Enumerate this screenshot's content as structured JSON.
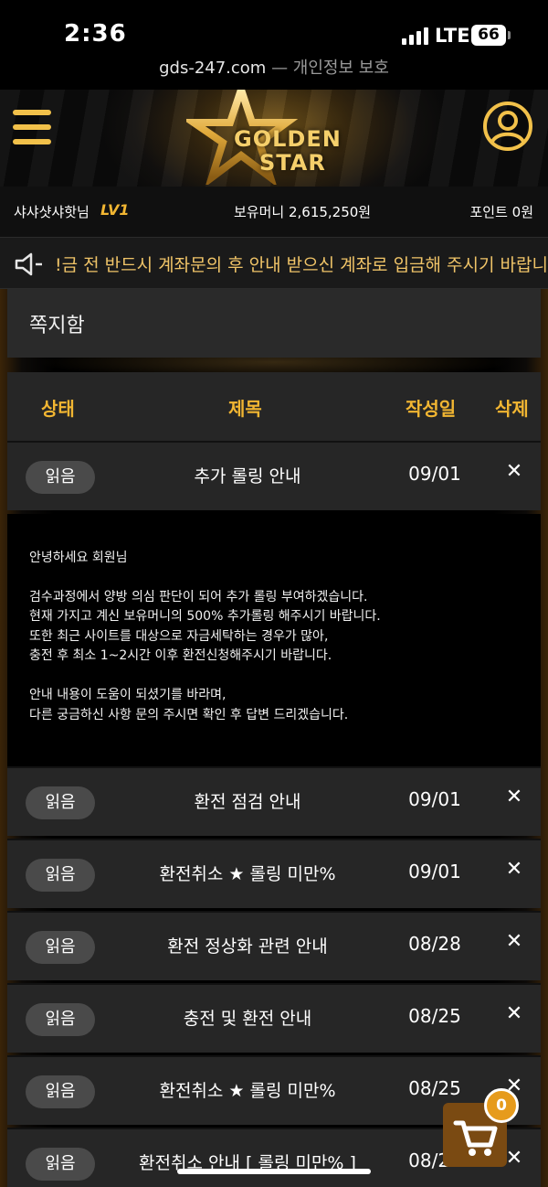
{
  "status_bar": {
    "time": "2:36",
    "network": "LTE",
    "battery": "66"
  },
  "url_bar": {
    "domain": "gds-247.com",
    "separator": " — ",
    "privacy": "개인정보 보호"
  },
  "header": {
    "logo_line1": "GOLDEN",
    "logo_line2": "STAR"
  },
  "user_info": {
    "nickname": "샤샤샷샤핫님",
    "level": "LV1",
    "money": "보유머니 2,615,250원",
    "points": "포인트 0원"
  },
  "notice": {
    "text": "!금 전 반드시 계좌문의 후 안내 받으신 계좌로 입금해 주시기 바랍니다"
  },
  "page": {
    "title": "쪽지함"
  },
  "table": {
    "headers": {
      "status": "상태",
      "subject": "제목",
      "date": "작성일",
      "delete": "삭제"
    },
    "rows": [
      {
        "status": "읽음",
        "subject": "추가 롤링 안내",
        "date": "09/01",
        "delete": "✕"
      },
      {
        "status": "읽음",
        "subject": "환전 점검 안내",
        "date": "09/01",
        "delete": "✕"
      },
      {
        "status": "읽음",
        "subject": "환전취소 ★ 롤링 미만%",
        "date": "09/01",
        "delete": "✕"
      },
      {
        "status": "읽음",
        "subject": "환전 정상화 관련 안내",
        "date": "08/28",
        "delete": "✕"
      },
      {
        "status": "읽음",
        "subject": "충전 및 환전 안내",
        "date": "08/25",
        "delete": "✕"
      },
      {
        "status": "읽음",
        "subject": "환전취소 ★ 롤링 미만%",
        "date": "08/25",
        "delete": "✕"
      },
      {
        "status": "읽음",
        "subject": "환전취소 안내 [ 롤링 미만% ]",
        "date": "08/24",
        "delete": "✕"
      }
    ]
  },
  "message": {
    "lines": [
      "안녕하세요 회원님",
      "검수과정에서 양방 의심 판단이 되어 추가 롤링 부여하겠습니다.",
      "현재 가지고 계신 보유머니의 500% 추가롤링 해주시기 바랍니다.",
      "또한 최근 사이트를 대상으로 자금세탁하는 경우가 많아,",
      "충전 후 최소 1~2시간 이후 환전신청해주시기 바랍니다.",
      "안내 내용이 도움이 되셨기를 바라며,",
      "다른 궁금하신 사항 문의 주시면 확인 후 답변 드리겠습니다."
    ]
  },
  "cart": {
    "count": "0"
  },
  "colors": {
    "accent": "#f2b632",
    "row_bg": "#262626",
    "badge_bg": "#4a4a4a"
  },
  "icons": [
    "hamburger-menu-icon",
    "user-circle-icon",
    "speaker-icon",
    "cart-icon"
  ]
}
